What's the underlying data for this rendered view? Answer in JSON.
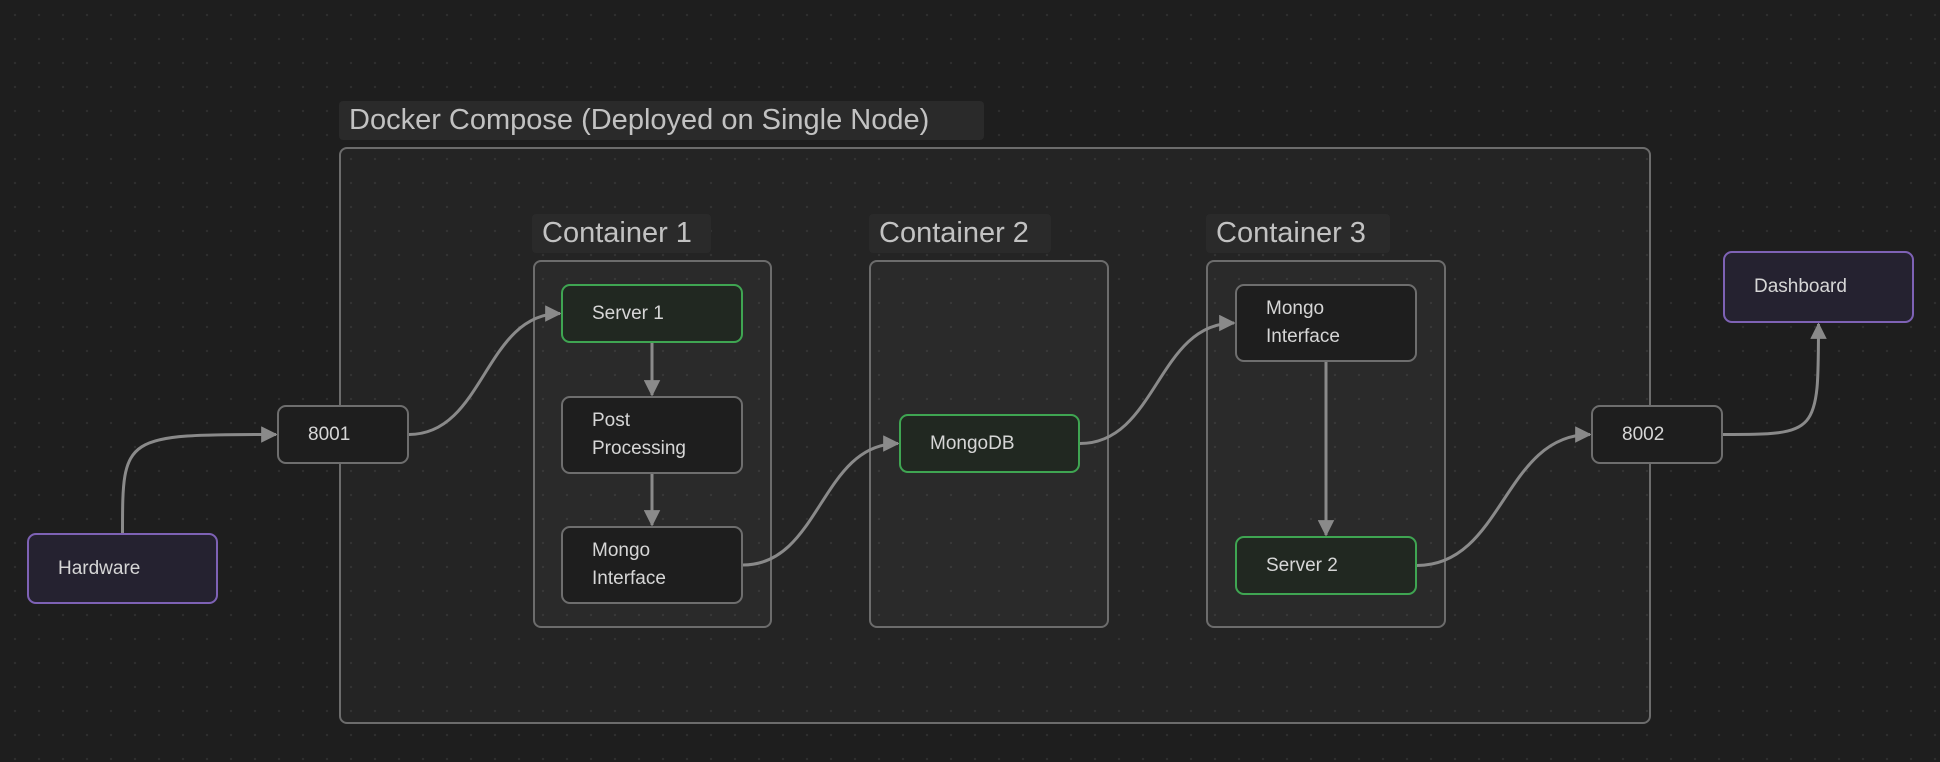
{
  "diagram": {
    "title": "Docker Compose (Deployed on Single Node)",
    "groups": [
      {
        "id": "docker",
        "label": "Docker Compose (Deployed on Single Node)"
      },
      {
        "id": "container1",
        "label": "Container 1"
      },
      {
        "id": "container2",
        "label": "Container 2"
      },
      {
        "id": "container3",
        "label": "Container 3"
      }
    ],
    "nodes": {
      "hardware": {
        "label": "Hardware",
        "style": "purple"
      },
      "port_8001": {
        "label": "8001",
        "style": "default"
      },
      "server1": {
        "label": "Server 1",
        "style": "green"
      },
      "post_processing": {
        "label": "Post\nProcessing",
        "style": "default"
      },
      "mongo_interface_1": {
        "label": "Mongo\nInterface",
        "style": "default"
      },
      "mongodb": {
        "label": "MongoDB",
        "style": "green"
      },
      "mongo_interface_2": {
        "label": "Mongo\nInterface",
        "style": "default"
      },
      "server2": {
        "label": "Server 2",
        "style": "green"
      },
      "port_8002": {
        "label": "8002",
        "style": "default"
      },
      "dashboard": {
        "label": "Dashboard",
        "style": "purple"
      }
    },
    "edges": [
      {
        "from": "hardware",
        "to": "port_8001"
      },
      {
        "from": "port_8001",
        "to": "server1"
      },
      {
        "from": "server1",
        "to": "post_processing"
      },
      {
        "from": "post_processing",
        "to": "mongo_interface_1"
      },
      {
        "from": "mongo_interface_1",
        "to": "mongodb"
      },
      {
        "from": "mongodb",
        "to": "mongo_interface_2"
      },
      {
        "from": "mongo_interface_2",
        "to": "server2"
      },
      {
        "from": "server2",
        "to": "port_8002"
      },
      {
        "from": "port_8002",
        "to": "dashboard"
      }
    ],
    "colors": {
      "canvas": "#1e1e1e",
      "edge": "#8a8a8a",
      "green_border": "#3fa552",
      "purple_border": "#7e62b5",
      "default_border": "#6e6e6e"
    }
  }
}
